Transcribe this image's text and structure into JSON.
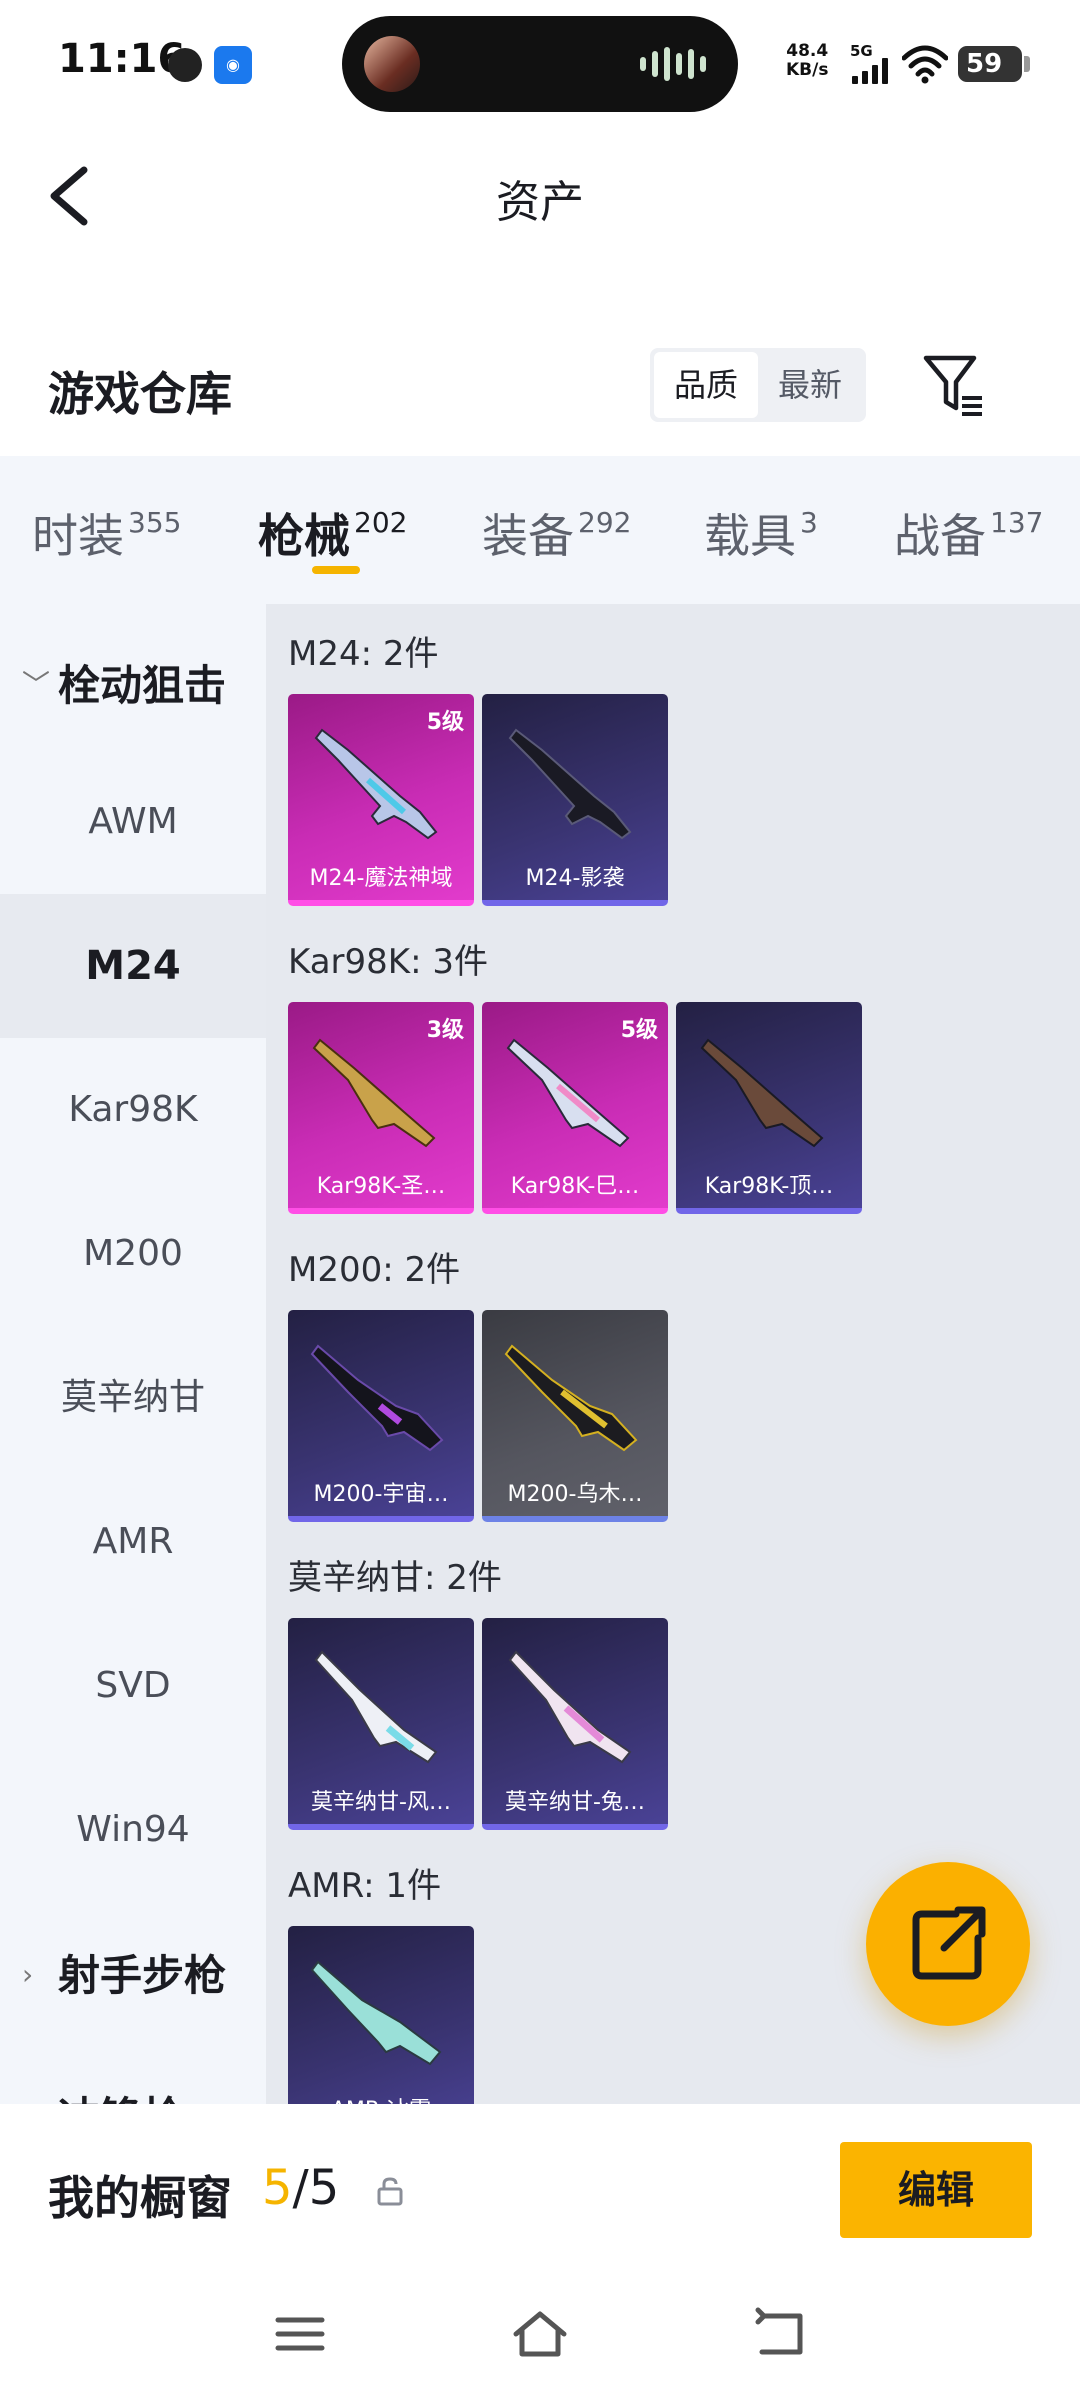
{
  "status_bar": {
    "time": "11:16",
    "net_speed_value": "48.4",
    "net_speed_unit": "KB/s",
    "network": "5G",
    "battery": "59",
    "icons": [
      "location-icon",
      "nfc-icon",
      "signal-icon",
      "wifi-icon",
      "battery-icon"
    ]
  },
  "header": {
    "title": "资产"
  },
  "warehouse": {
    "title": "游戏仓库",
    "sort_options": [
      "品质",
      "最新"
    ],
    "sort_selected": "品质"
  },
  "categories": [
    {
      "label": "时装",
      "count": "355"
    },
    {
      "label": "枪械",
      "count": "202"
    },
    {
      "label": "装备",
      "count": "292"
    },
    {
      "label": "载具",
      "count": "3"
    },
    {
      "label": "战备",
      "count": "137"
    }
  ],
  "active_category": "枪械",
  "sidebar": {
    "group_open": "栓动狙击",
    "items": [
      "AWM",
      "M24",
      "Kar98K",
      "M200",
      "莫辛纳甘",
      "AMR",
      "SVD",
      "Win94"
    ],
    "active_item": "M24",
    "group_closed": "射手步枪",
    "group_partial": "冲锋枪"
  },
  "groups": [
    {
      "title": "M24: 2件",
      "items": [
        {
          "name": "M24-魔法神域",
          "level": "5级",
          "quality": "pink"
        },
        {
          "name": "M24-影袭",
          "level": "",
          "quality": "purple"
        }
      ]
    },
    {
      "title": "Kar98K: 3件",
      "items": [
        {
          "name": "Kar98K-圣…",
          "level": "3级",
          "quality": "pink"
        },
        {
          "name": "Kar98K-巳…",
          "level": "5级",
          "quality": "pink"
        },
        {
          "name": "Kar98K-顶…",
          "level": "",
          "quality": "purple"
        }
      ]
    },
    {
      "title": "M200: 2件",
      "items": [
        {
          "name": "M200-宇宙…",
          "level": "",
          "quality": "purple"
        },
        {
          "name": "M200-乌木…",
          "level": "",
          "quality": "gray"
        }
      ]
    },
    {
      "title": "莫辛纳甘: 2件",
      "items": [
        {
          "name": "莫辛纳甘-风…",
          "level": "",
          "quality": "purple"
        },
        {
          "name": "莫辛纳甘-兔…",
          "level": "",
          "quality": "purple"
        }
      ]
    },
    {
      "title": "AMR: 1件",
      "items": [
        {
          "name": "AMR-冰霜",
          "level": "",
          "quality": "purple"
        }
      ]
    }
  ],
  "showcase": {
    "label": "我的橱窗",
    "current": "5",
    "total": "/5",
    "edit_label": "编辑"
  },
  "colors": {
    "accent": "#fbb400",
    "pink_quality": "#c92cb5",
    "purple_quality": "#3a3472",
    "gray_quality": "#55565f"
  }
}
